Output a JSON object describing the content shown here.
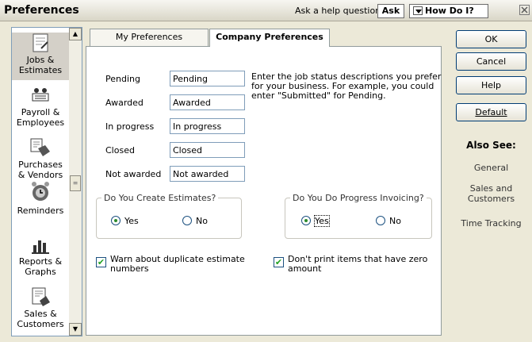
{
  "window": {
    "title": "Preferences",
    "help_prompt": "Ask a help question",
    "ask_button": "Ask",
    "how_do_i": "How Do I?"
  },
  "nav": {
    "items": [
      {
        "label": "Jobs &\nEstimates",
        "icon": "jobs-estimates-icon"
      },
      {
        "label": "Payroll &\nEmployees",
        "icon": "payroll-icon"
      },
      {
        "label": "Purchases\n& Vendors",
        "icon": "purchases-icon"
      },
      {
        "label": "Reminders",
        "icon": "reminders-icon"
      },
      {
        "label": "Reports &\nGraphs",
        "icon": "reports-icon"
      },
      {
        "label": "Sales &\nCustomers",
        "icon": "sales-icon"
      }
    ]
  },
  "tabs": {
    "my_prefs": "My Preferences",
    "company_prefs": "Company Preferences"
  },
  "form": {
    "pending_label": "Pending",
    "pending_value": "Pending",
    "awarded_label": "Awarded",
    "awarded_value": "Awarded",
    "inprogress_label": "In progress",
    "inprogress_value": "In progress",
    "closed_label": "Closed",
    "closed_value": "Closed",
    "notawarded_label": "Not awarded",
    "notawarded_value": "Not awarded",
    "info_text": "Enter the job status descriptions you prefer for your business.  For example, you could enter \"Submitted\" for Pending.",
    "estimates_group": "Do You Create Estimates?",
    "estimates_yes": "Yes",
    "estimates_no": "No",
    "invoicing_group": "Do You Do Progress Invoicing?",
    "invoicing_yes": "Yes",
    "invoicing_no": "No",
    "warn_dup": "Warn about duplicate estimate numbers",
    "dont_print_zero": "Don't print items that have zero amount"
  },
  "buttons": {
    "ok": "OK",
    "cancel": "Cancel",
    "help": "Help",
    "default": "Default"
  },
  "also_see": {
    "heading": "Also See:",
    "links": [
      "General",
      "Sales and\nCustomers",
      "Time Tracking"
    ]
  },
  "colors": {
    "check": "#21a121",
    "dialog_bg": "#ece9d8",
    "border": "#7f9db9"
  }
}
